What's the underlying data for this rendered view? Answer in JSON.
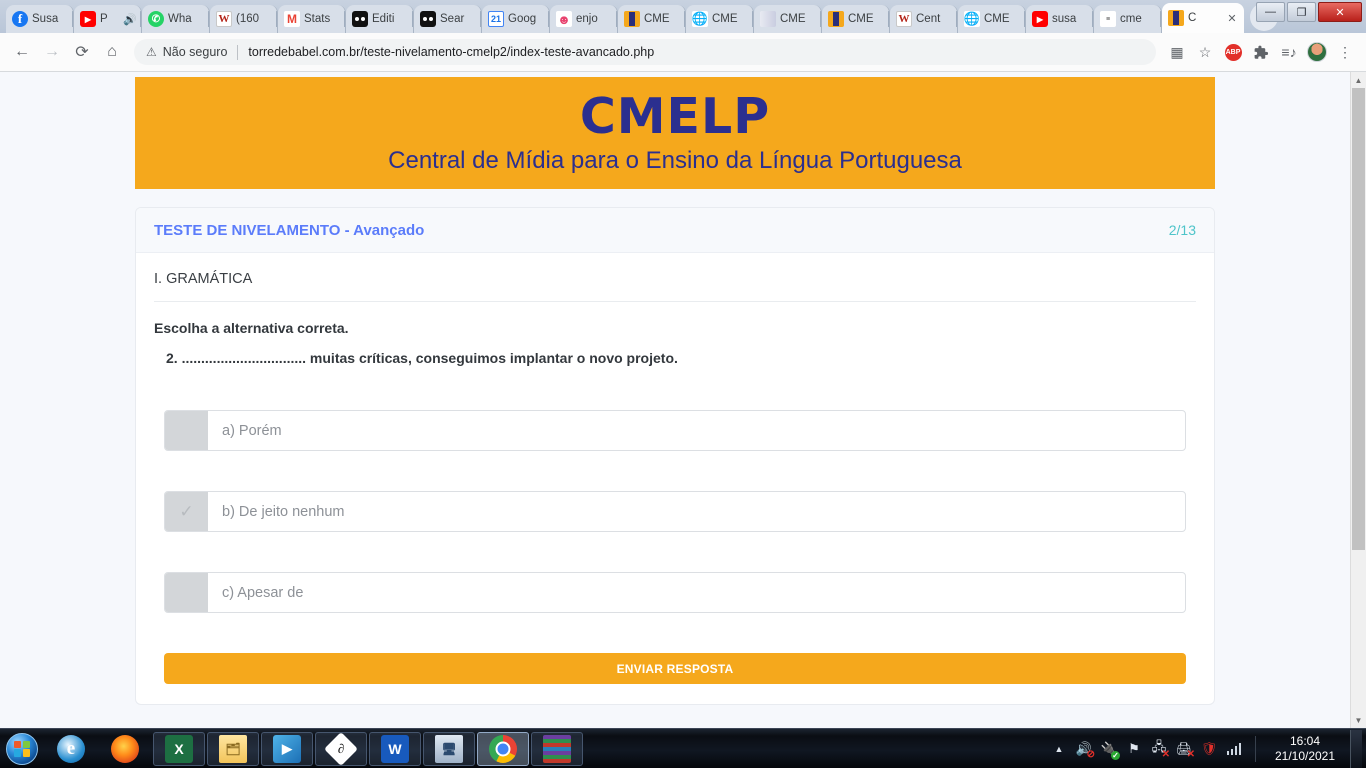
{
  "browser": {
    "tabs": [
      {
        "title": "Susa",
        "icon": "facebook-icon"
      },
      {
        "title": "P",
        "icon": "youtube-icon",
        "audio": "🔊"
      },
      {
        "title": "Wha",
        "icon": "whatsapp-icon"
      },
      {
        "title": "(160",
        "icon": "word-icon"
      },
      {
        "title": "Stats",
        "icon": "gmail-icon"
      },
      {
        "title": "Editi",
        "icon": "black-dots-icon"
      },
      {
        "title": "Sear",
        "icon": "black-dots-icon"
      },
      {
        "title": "Goog",
        "icon": "google-calendar-icon"
      },
      {
        "title": "enjo",
        "icon": "enjoei-icon"
      },
      {
        "title": "CME",
        "icon": "cmelp-icon"
      },
      {
        "title": "CME",
        "icon": "globe-icon"
      },
      {
        "title": "CME",
        "icon": "grey-page-icon"
      },
      {
        "title": "CME",
        "icon": "cmelp-icon"
      },
      {
        "title": "Cent",
        "icon": "word-icon"
      },
      {
        "title": "CME",
        "icon": "globe-icon"
      },
      {
        "title": "susa",
        "icon": "youtube-icon"
      },
      {
        "title": "cme",
        "icon": "doc-icon"
      },
      {
        "title": "C",
        "icon": "cmelp-icon",
        "active": true,
        "close": "✕"
      }
    ],
    "new_tab_label": "+",
    "window_controls": {
      "minimize": "—",
      "maximize": "❐",
      "close": "✕"
    },
    "nav": {
      "back": "←",
      "forward": "→",
      "reload": "⟳",
      "home": "⌂"
    },
    "omnibox": {
      "warning_icon": "⚠",
      "security_label": "Não seguro",
      "url": "torredebabel.com.br/teste-nivelamento-cmelp2/index-teste-avancado.php"
    },
    "toolbar_icons": [
      {
        "name": "qr-code-icon",
        "glyph": "▦"
      },
      {
        "name": "bookmark-star-icon",
        "glyph": "☆"
      },
      {
        "name": "adblock-plus-icon",
        "glyph": "ABP"
      },
      {
        "name": "extensions-puzzle-icon",
        "glyph": "🧩"
      },
      {
        "name": "reading-list-icon",
        "glyph": "≡♪"
      },
      {
        "name": "profile-avatar-icon",
        "glyph": ""
      },
      {
        "name": "chrome-menu-icon",
        "glyph": "⋮"
      }
    ]
  },
  "page": {
    "banner": {
      "logo": "CMELP",
      "subtitle": "Central de Mídia para o Ensino da Língua Portuguesa",
      "bg_color": "#f5a81c",
      "text_color": "#2b2f8f"
    },
    "card": {
      "title": "TESTE DE NIVELAMENTO - Avançado",
      "counter": "2/13",
      "title_color": "#5b7cfa",
      "counter_color": "#4ec4c9",
      "section_title": "I. GRAMÁTICA",
      "instruction": "Escolha a alternativa correta.",
      "question": "2. ................................ muitas críticas, conseguimos implantar o novo projeto.",
      "options": [
        {
          "label": "a) Porém",
          "checked": false,
          "mark": ""
        },
        {
          "label": "b) De jeito nenhum",
          "checked": true,
          "mark": "✓"
        },
        {
          "label": "c) Apesar de",
          "checked": false,
          "mark": ""
        }
      ],
      "submit_label": "ENVIAR RESPOSTA"
    }
  },
  "taskbar": {
    "start_label": "Iniciar",
    "items": [
      {
        "name": "internet-explorer-icon",
        "glyph": "e",
        "state": "pinned"
      },
      {
        "name": "firefox-icon",
        "glyph": "",
        "state": "pinned"
      },
      {
        "name": "excel-icon",
        "glyph": "X",
        "state": "running"
      },
      {
        "name": "file-explorer-icon",
        "glyph": "🗂",
        "state": "running"
      },
      {
        "name": "media-player-icon",
        "glyph": "▶",
        "state": "running"
      },
      {
        "name": "diamond-app-icon",
        "glyph": "∂",
        "state": "running"
      },
      {
        "name": "word-icon",
        "glyph": "W",
        "state": "running"
      },
      {
        "name": "remote-desktop-icon",
        "glyph": "🖥",
        "state": "running"
      },
      {
        "name": "chrome-icon",
        "glyph": "",
        "state": "active"
      },
      {
        "name": "winrar-icon",
        "glyph": "",
        "state": "running"
      }
    ],
    "tray": [
      {
        "name": "show-hidden-icons-icon",
        "glyph": "▲"
      },
      {
        "name": "volume-muted-icon",
        "glyph": "🔊"
      },
      {
        "name": "usb-safe-remove-icon",
        "glyph": "🔌"
      },
      {
        "name": "flag-action-center-icon",
        "glyph": "⚑"
      },
      {
        "name": "network-disconnected-icon",
        "glyph": "🖧"
      },
      {
        "name": "printer-error-icon",
        "glyph": "🖨"
      },
      {
        "name": "security-shield-icon",
        "glyph": "🛡"
      },
      {
        "name": "signal-bars-icon",
        "glyph": ""
      }
    ],
    "clock": {
      "time": "16:04",
      "date": "21/10/2021"
    }
  }
}
